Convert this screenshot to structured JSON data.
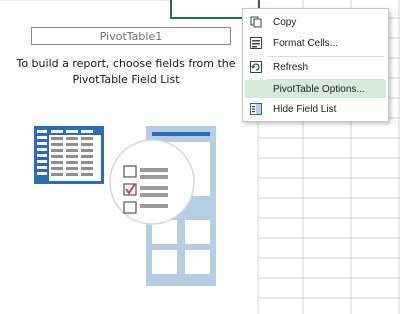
{
  "pivot": {
    "title": "PivotTable1",
    "instruction_line1": "To build a report, choose fields from the",
    "instruction_line2": "PivotTable Field List"
  },
  "context_menu": {
    "items": [
      {
        "label": "Copy",
        "icon": "copy-icon"
      },
      {
        "label": "Format Cells...",
        "icon": "format-cells-icon"
      },
      {
        "label": "Refresh",
        "icon": "refresh-icon"
      },
      {
        "label": "PivotTable Options...",
        "icon": "",
        "highlighted": true
      },
      {
        "label": "Hide Field List",
        "icon": "field-list-icon"
      }
    ]
  },
  "colors": {
    "grid_line": "#d4d4d4",
    "selected_cell_border": "#217346",
    "menu_highlight": "#d6ebd8",
    "illustration_blue": "#2b6cb5",
    "illustration_panel": "#b7cde4",
    "checkbox_check": "#d9463b"
  }
}
